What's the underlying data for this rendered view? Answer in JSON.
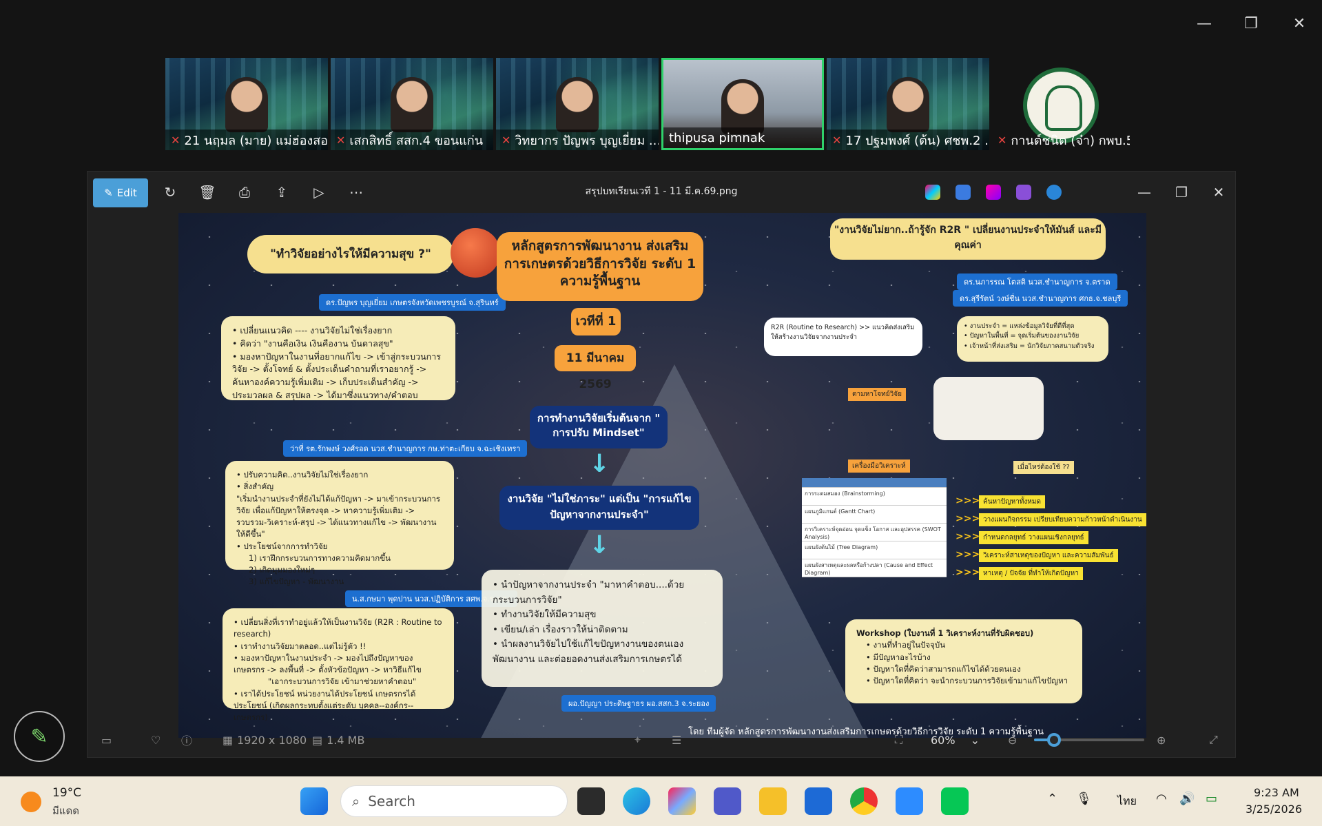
{
  "window_controls": {
    "minimize": "—",
    "restore": "❐",
    "close": "✕"
  },
  "participants": [
    {
      "name": "21 นฤมล (มาย) แม่ฮ่องสอน",
      "muted": true
    },
    {
      "name": "เสกสิทธิ์ สสก.4 ขอนแก่น",
      "muted": true
    },
    {
      "name": "วิทยากร ปัญพร บุญเยี่ยม ...",
      "muted": true
    },
    {
      "name": "thipusa pimnak",
      "muted": false
    },
    {
      "name": "17 ปฐมพงศ์ (ต้น) ศชพ.2 ...",
      "muted": true
    },
    {
      "name": "กานต์ชนิต (จ๋า) กพบ.5",
      "muted": true
    }
  ],
  "viewer": {
    "edit_label": "Edit",
    "file_title": "สรุปบทเรียนเวที 1 - 11 มี.ค.69.png",
    "dimensions": "1920 x 1080",
    "file_size": "1.4 MB",
    "zoom": "60%",
    "zoom_fraction": 0.18
  },
  "infographic": {
    "title_q": "\"ทำวิจัยอย่างไรให้มีความสุข ?\"",
    "course_title": "หลักสูตรการพัฒนางาน ส่งเสริมการเกษตรด้วยวิธีการวิจัย ระดับ 1 ความรู้พื้นฐาน",
    "session": "เวทีที่ 1",
    "date": "11 มีนาคม 2569",
    "r2r_banner": "\"งานวิจัยไม่ยาก..ถ้ารู้จัก R2R \" เปลี่ยนงานประจำให้มันส์ และมีคุณค่า",
    "speaker1": "ดร.ปัญพร บุญเยี่ยม เกษตรจังหวัดเพชรบูรณ์ จ.สุรินทร์",
    "box1": [
      "เปลี่ยนแนวคิด ---- งานวิจัยไม่ใช่เรื่องยาก",
      "คิดว่า \"งานคือเงิน เงินคืองาน บันดาลสุข\"",
      "มองหาปัญหาในงานที่อยากแก้ไข -> เข้าสู่กระบวนการวิจัย -> ตั้งโจทย์ & ตั้งประเด็นคำถามที่เราอยากรู้ -> ค้นหาองค์ความรู้เพิ่มเติม -> เก็บประเด็นสำคัญ -> ประมวลผล & สรุปผล -> ได้มาซึ่งแนวทาง/คำตอบ"
    ],
    "speaker2": "ว่าที่ รต.รักพงษ์ วงศ์รอด นวส.ชำนาญการ กษ.ท่าตะเกียบ จ.ฉะเชิงเทรา",
    "box2": [
      "ปรับความคิด..งานวิจัยไม่ใช่เรื่องยาก",
      "สิ่งสำคัญ",
      "\"เริ่มนำงานประจำที่ยังไม่ได้แก้ปัญหา -> มาเข้ากระบวนการวิจัย เพื่อแก้ปัญหาให้ตรงจุด -> หาความรู้เพิ่มเติม -> รวบรวม-วิเคราะห์-สรุป -> ได้แนวทางแก้ไข -> พัฒนางานให้ดีขึ้น\"",
      "ประโยชน์จากการทำวิจัย",
      "1) เราฝึกกระบวนการทางความคิดมากขึ้น",
      "2) เกิดมุมมองใหม่ๆ",
      "3) แก้ไขปัญหา - พัฒนางาน"
    ],
    "speaker3": "น.ส.กษมา พุดปาน นวส.ปฏิบัติการ สศพ.จ.ระยอง",
    "box3": [
      "เปลี่ยนสิ่งที่เราทำอยู่แล้วให้เป็นงานวิจัย (R2R : Routine to research)",
      "เราทำงานวิจัยมาตลอด..แต่ไม่รู้ตัว !!",
      "มองหาปัญหาในงานประจำ -> มองไปถึงปัญหาของเกษตรกร -> ลงพื้นที่ -> ตั้งหัวข้อปัญหา -> หาวิธีแก้ไข",
      "\"เอากระบวนการวิจัย เข้ามาช่วยหาคำตอบ\"",
      "เราได้ประโยชน์ หน่วยงานได้ประโยชน์ เกษตรกรได้ประโยชน์ (เกิดผลกระทบตั้งแต่ระดับ บุคคล--องค์กร--เกษตรกร)"
    ],
    "mindset": "การทำงานวิจัยเริ่มต้นจาก \" การปรับ Mindset\"",
    "not_burden": "งานวิจัย \"ไม่ใช่ภาระ\" แต่เป็น \"การแก้ไขปัญหาจากงานประจำ\"",
    "center_list": [
      "นำปัญหาจากงานประจำ \"มาหาคำตอบ....ด้วยกระบวนการวิจัย\"",
      "ทำงานวิจัยให้มีความสุข",
      "เขียน/เล่า เรื่องราวให้น่าติดตาม",
      "นำผลงานวิจัยไปใช้แก้ไขปัญหางานของตนเอง พัฒนางาน และต่อยอดงานส่งเสริมการเกษตรได้"
    ],
    "speaker_center": "ผอ.ปัญญา ประดิษฐาธร ผอ.สสก.3 จ.ระยอง",
    "speakers_right": [
      "ดร.นภารรณ โตสติ นวส.ชำนาญการ จ.ตราด",
      "ดร.สุรีรัตน์ วงษ์ชื่น นวส.ชำนาญการ ศกธ.จ.ชลบุรี"
    ],
    "r2r_def": "R2R (Routine to Research) >> แนวคิดส่งเสริมให้สร้างงานวิจัยจากงานประจำ",
    "r2r_points": [
      "งานประจำ = แหล่งข้อมูลวิจัยที่ดีที่สุด",
      "ปัญหาในพื้นที่ = จุดเริ่มต้นของงานวิจัย",
      "เจ้าหน้าที่ส่งเสริม = นักวิจัยภาคสนามตัวจริง"
    ],
    "find_problem": "ตามหาโจทย์วิจัย",
    "tools_label": "เครื่องมือวิเคราะห์",
    "when_label": "เมื่อไหร่ต้องใช้ ??",
    "tools": [
      {
        "tool": "การระดมสมอง (Brainstorming)",
        "when": "ค้นหาปัญหาทั้งหมด"
      },
      {
        "tool": "แผนภูมิแกนต์ (Gantt Chart)",
        "when": "วางแผนกิจกรรม เปรียบเทียบความก้าวหน้าดำเนินงาน"
      },
      {
        "tool": "การวิเคราะห์จุดอ่อน จุดแข็ง โอกาส และอุปสรรค (SWOT Analysis)",
        "when": "กำหนดกลยุทธ์ วางแผนเชิงกลยุทธ์"
      },
      {
        "tool": "แผนผังต้นไม้ (Tree Diagram)",
        "when": "วิเคราะห์สาเหตุของปัญหา และความสัมพันธ์"
      },
      {
        "tool": "แผนผังสาเหตุและผลหรือก้างปลา (Cause and Effect Diagram)",
        "when": "หาเหตุ / ปัจจัย ที่ทำให้เกิดปัญหา"
      }
    ],
    "workshop": [
      "Workshop (ใบงานที่ 1 วิเคราะห์งานที่รับผิดชอบ)",
      "งานที่ทำอยู่ในปัจจุบัน",
      "มีปัญหาอะไรบ้าง",
      "ปัญหาใดที่คิดว่าสามารถแก้ไขได้ด้วยตนเอง",
      "ปัญหาใดที่คิดว่า จะนำกระบวนการวิจัยเข้ามาแก้ไขปัญหา"
    ],
    "footer": "โดย ทีมผู้จัด หลักสูตรการพัฒนางานส่งเสริมการเกษตรด้วยวิธีการวิจัย ระดับ 1 ความรู้พื้นฐาน"
  },
  "taskbar": {
    "temperature": "19°C",
    "weather": "มีแดด",
    "search_placeholder": "Search",
    "language": "ไทย",
    "time": "9:23 AM",
    "date": "3/25/2026"
  }
}
